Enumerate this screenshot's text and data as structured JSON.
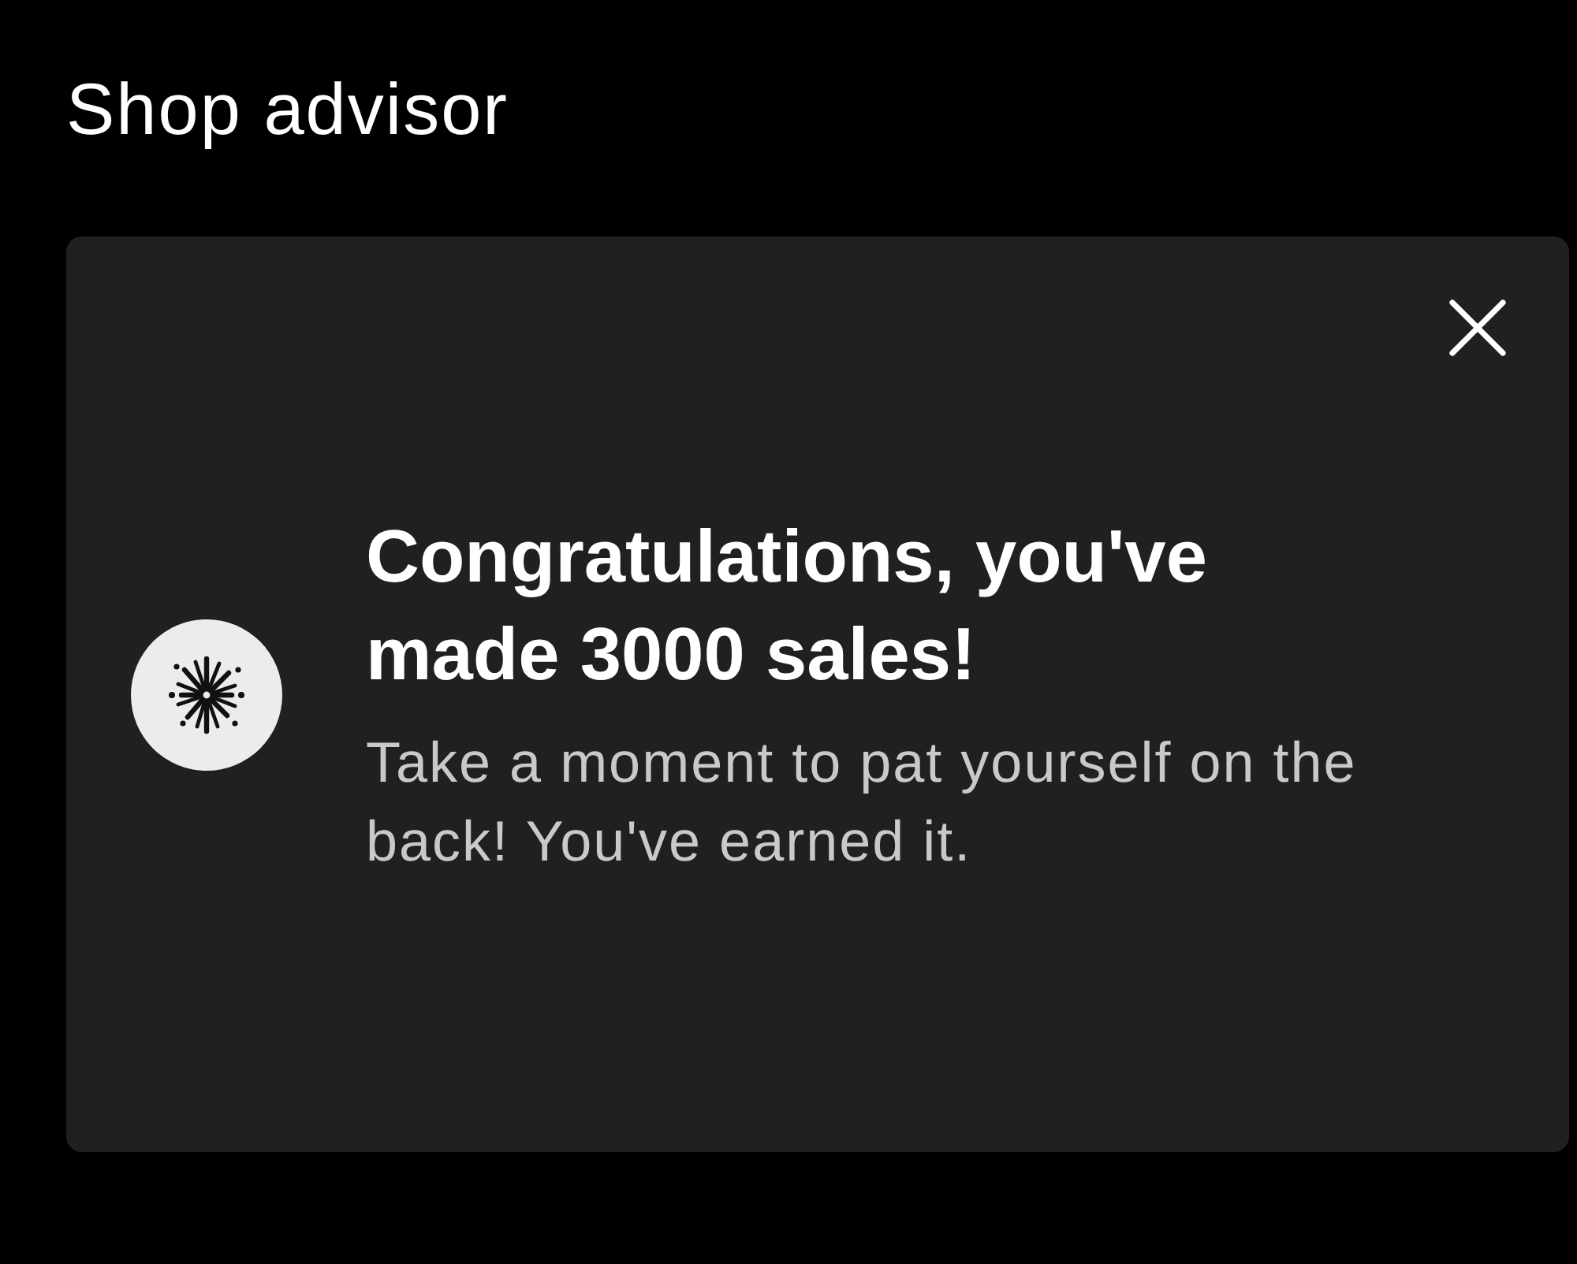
{
  "header": {
    "title": "Shop advisor"
  },
  "card": {
    "title": "Congratulations, you've made 3000 sales!",
    "message": "Take a moment to pat yourself on the back! You've earned it."
  }
}
